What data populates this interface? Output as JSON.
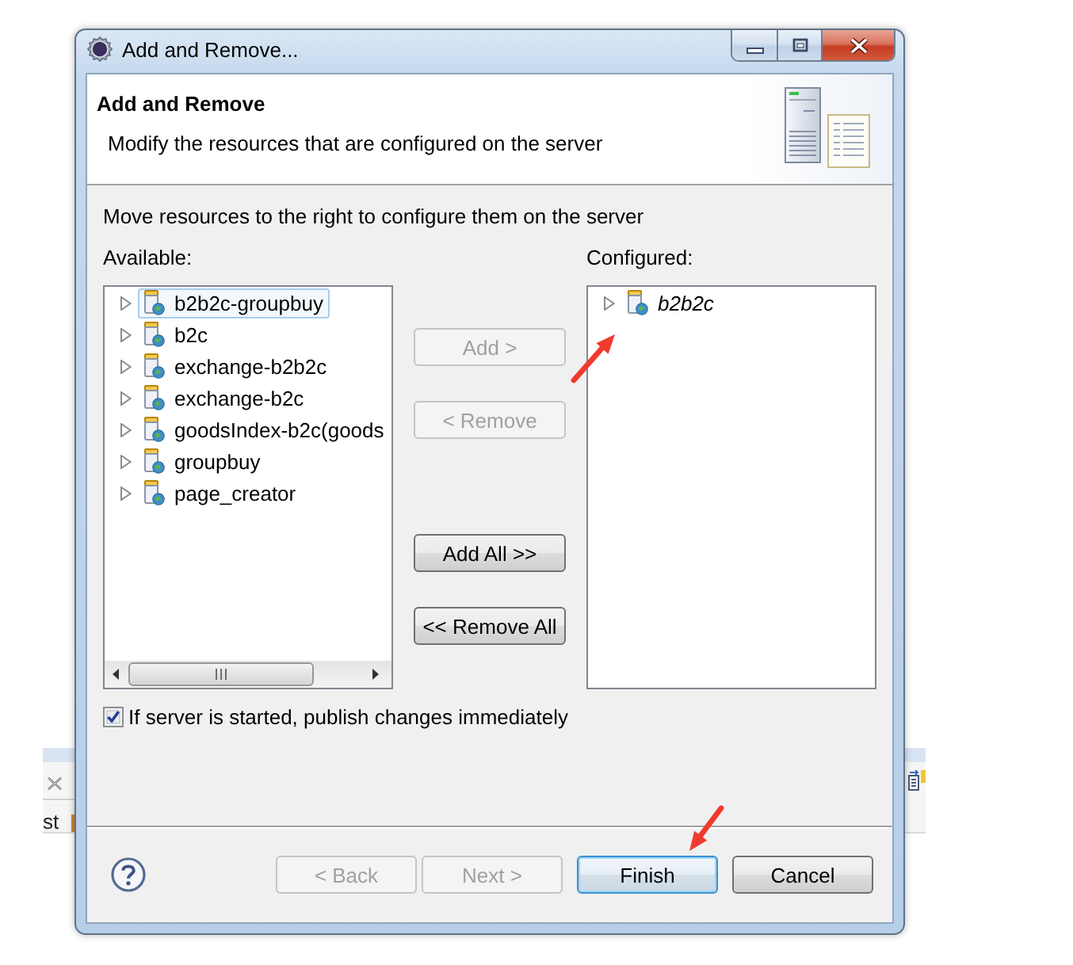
{
  "background_window": {
    "tab_label": "st"
  },
  "dialog": {
    "title": "Add and Remove..."
  },
  "header": {
    "title": "Add and Remove",
    "description": "Modify the resources that are configured on the server"
  },
  "instruction": "Move resources to the right to configure them on the server",
  "available": {
    "label": "Available:",
    "items": [
      {
        "name": "b2b2c-groupbuy",
        "expanded": false,
        "selected": true
      },
      {
        "name": "b2c",
        "expanded": false,
        "selected": false
      },
      {
        "name": "exchange-b2b2c",
        "expanded": false,
        "selected": false
      },
      {
        "name": "exchange-b2c",
        "expanded": false,
        "selected": false
      },
      {
        "name": "goodsIndex-b2c(goods",
        "expanded": false,
        "selected": false
      },
      {
        "name": "groupbuy",
        "expanded": false,
        "selected": false
      },
      {
        "name": "page_creator",
        "expanded": false,
        "selected": false
      }
    ]
  },
  "move_buttons": [
    {
      "label": "Add >",
      "disabled": true
    },
    {
      "label": "< Remove",
      "disabled": true
    },
    {
      "label": "Add All >>",
      "disabled": false
    },
    {
      "label": "<< Remove All",
      "disabled": false
    }
  ],
  "configured": {
    "label": "Configured:",
    "items": [
      {
        "name": "b2b2c",
        "expanded": false,
        "selected": false
      }
    ]
  },
  "publish_option": {
    "label": "If server is started, publish changes immediately",
    "checked": true
  },
  "footer_buttons": [
    {
      "label": "< Back",
      "disabled": true,
      "default": false
    },
    {
      "label": "Next >",
      "disabled": true,
      "default": false
    },
    {
      "label": "Finish",
      "disabled": false,
      "default": true
    },
    {
      "label": "Cancel",
      "disabled": false,
      "default": false
    }
  ]
}
